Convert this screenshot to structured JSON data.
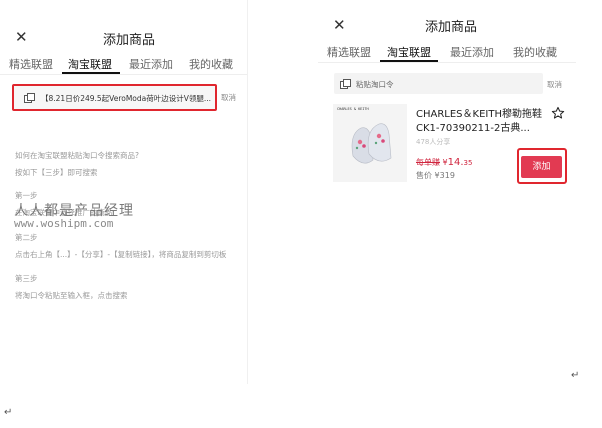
{
  "left": {
    "close_glyph": "✕",
    "title": "添加商品",
    "tabs": [
      {
        "label": "精选联盟",
        "active": false
      },
      {
        "label": "淘宝联盟",
        "active": true
      },
      {
        "label": "最近添加",
        "active": false
      },
      {
        "label": "我的收藏",
        "active": false
      }
    ],
    "clipboard_text": "【8.21日价249.5起VeroModa荷叶边设计V领腿...",
    "cancel_label": "取消",
    "help": {
      "question": "如何在淘宝联盟粘贴淘口令搜索商品?",
      "intro": "按如下【三步】即可搜索",
      "step1_title": "第一步",
      "step1_text": "在淘宝联盟中选择推广的商品",
      "step2_title": "第二步",
      "step2_text": "点击右上角【...】-【分享】-【复制链接】，将商品复制到剪切板",
      "step3_title": "第三步",
      "step3_text": "将淘口令粘贴至输入框，点击搜索"
    },
    "watermark_cn": "人人都是产品经理",
    "watermark_url": "www.woshipm.com"
  },
  "right": {
    "close_glyph": "✕",
    "title": "添加商品",
    "tabs": [
      {
        "label": "精选联盟",
        "active": false
      },
      {
        "label": "淘宝联盟",
        "active": true
      },
      {
        "label": "最近添加",
        "active": false
      },
      {
        "label": "我的收藏",
        "active": false
      }
    ],
    "search_placeholder": "粘贴淘口令",
    "cancel_label": "取消",
    "product": {
      "brand_on_image": "CHARLES & KEITH",
      "title": "CHARLES＆KEITH穆勒拖鞋CK1-70390211-2古典...",
      "sales": "478人分享",
      "earn_label": "每单赚",
      "earn_currency": " ¥",
      "earn_int": "14.",
      "earn_dec": "35",
      "price_label": "售价",
      "price_value": " ¥319",
      "add_label": "添加"
    }
  },
  "return_mark": "↵",
  "colors": {
    "accent": "#e0262e",
    "button": "#e23a52"
  }
}
